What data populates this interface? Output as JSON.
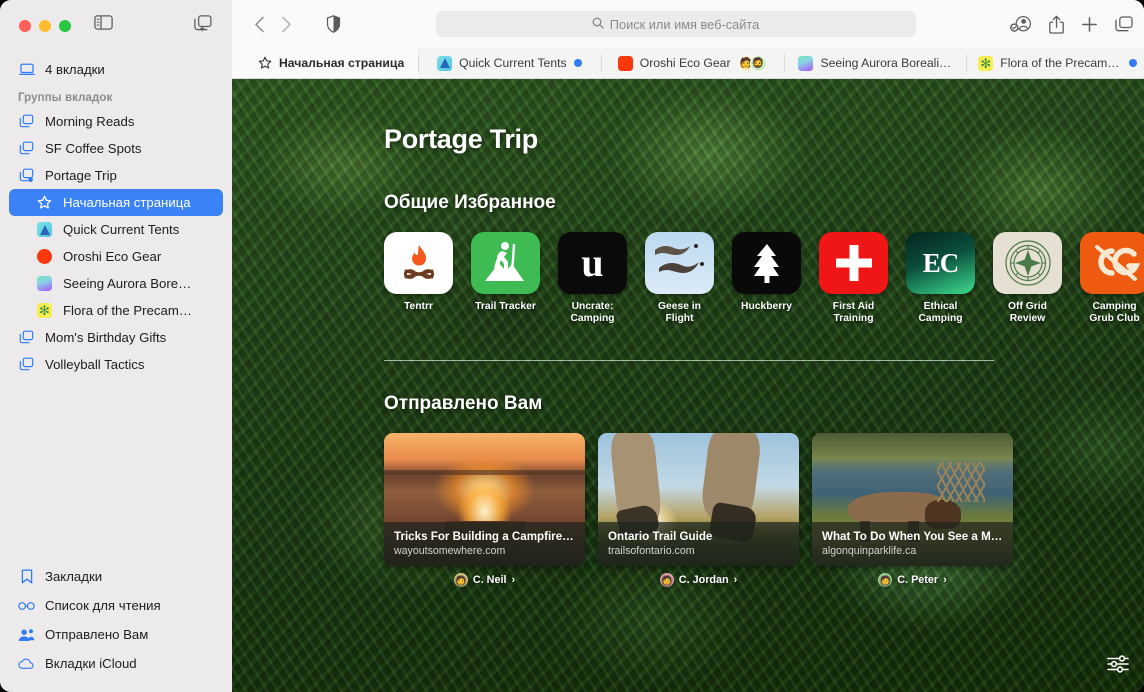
{
  "window": {
    "traffic_lights": [
      "close",
      "minimize",
      "zoom"
    ],
    "sidebar_toggle": "sidebar-toggle",
    "new_tab_group": "new-tab-group"
  },
  "sidebar": {
    "local_tabs": {
      "label": "4 вкладки",
      "icon": "laptop-icon"
    },
    "section_header": "Группы вкладок",
    "groups": [
      {
        "label": "Morning Reads",
        "icon": "tab-group-icon",
        "selected": false
      },
      {
        "label": "SF Coffee Spots",
        "icon": "tab-group-icon",
        "selected": false
      },
      {
        "label": "Portage Trip",
        "icon": "tab-group-shared-icon",
        "selected": false
      }
    ],
    "portage_children": [
      {
        "label": "Начальная страница",
        "icon": "star-icon",
        "selected": true
      },
      {
        "label": "Quick Current Tents",
        "icon": "favicon-tents",
        "selected": false
      },
      {
        "label": "Oroshi Eco Gear",
        "icon": "favicon-oroshi",
        "selected": false
      },
      {
        "label": "Seeing Aurora Bore…",
        "icon": "favicon-aurora",
        "selected": false
      },
      {
        "label": "Flora of the Precam…",
        "icon": "favicon-flora",
        "selected": false
      }
    ],
    "groups_after": [
      {
        "label": "Mom's Birthday Gifts",
        "icon": "tab-group-icon",
        "selected": false
      },
      {
        "label": "Volleyball Tactics",
        "icon": "tab-group-icon",
        "selected": false
      }
    ],
    "bottom": [
      {
        "label": "Закладки",
        "icon": "bookmark-icon"
      },
      {
        "label": "Список для чтения",
        "icon": "glasses-icon"
      },
      {
        "label": "Отправлено Вам",
        "icon": "shared-with-you-icon"
      },
      {
        "label": "Вкладки iCloud",
        "icon": "icloud-icon"
      }
    ]
  },
  "toolbar": {
    "back": "back-icon",
    "forward": "forward-icon",
    "shield": "privacy-shield-icon",
    "address_placeholder": "Поиск или имя веб-сайта",
    "search_icon": "search-icon",
    "profile": "profile-icon",
    "share": "share-icon",
    "new_tab": "plus-icon",
    "tab_overview": "tab-overview-icon"
  },
  "tabs": [
    {
      "label": "Начальная страница",
      "icon": "star-icon",
      "active": true,
      "unread": false,
      "avatars": []
    },
    {
      "label": "Quick Current Tents",
      "icon": "favicon-tents",
      "active": false,
      "unread": true,
      "avatars": []
    },
    {
      "label": "Oroshi Eco Gear",
      "icon": "favicon-oroshi",
      "active": false,
      "unread": false,
      "avatars": [
        "🧑",
        "🧔🏿"
      ]
    },
    {
      "label": "Seeing Aurora Boreali…",
      "icon": "favicon-aurora",
      "active": false,
      "unread": false,
      "avatars": []
    },
    {
      "label": "Flora of the Precambi…",
      "icon": "favicon-flora",
      "active": false,
      "unread": true,
      "avatars": []
    }
  ],
  "start_page": {
    "title": "Portage Trip",
    "favorites_heading": "Общие Избранное",
    "favorites": [
      {
        "label": "Tentrr",
        "art": "campfire-logo"
      },
      {
        "label": "Trail Tracker",
        "art": "hiker-logo"
      },
      {
        "label": "Uncrate: Camping",
        "art": "letter-u-logo"
      },
      {
        "label": "Geese in Flight",
        "art": "geese-photo"
      },
      {
        "label": "Huckberry",
        "art": "pine-tree-logo"
      },
      {
        "label": "First Aid Training",
        "art": "red-cross-logo"
      },
      {
        "label": "Ethical Camping",
        "art": "ec-monogram-logo"
      },
      {
        "label": "Off Grid Review",
        "art": "compass-logo"
      },
      {
        "label": "Camping Grub Club",
        "art": "cg-monogram-logo"
      }
    ],
    "shared_heading": "Отправлено Вам",
    "shared_cards": [
      {
        "title": "Tricks For Building a Campfire—F…",
        "url": "wayoutsomewhere.com",
        "sender": "C. Neil",
        "image": "campfire-at-dusk-photo",
        "avatar_emoji": "🧑",
        "avatar_color": "#dfc98a"
      },
      {
        "title": "Ontario Trail Guide",
        "url": "trailsofontario.com",
        "sender": "C. Jordan",
        "image": "hikers-legs-sunset-photo",
        "avatar_emoji": "🧑🏽",
        "avatar_color": "#e8a9b8"
      },
      {
        "title": "What To Do When You See a Moo…",
        "url": "algonquinparklife.ca",
        "sender": "C. Peter",
        "image": "elk-by-river-photo",
        "avatar_emoji": "🧑🏽",
        "avatar_color": "#a8d8a0"
      }
    ],
    "settings_button": "start-page-settings-icon"
  },
  "colors": {
    "accent": "#3b82f7",
    "sidebar_bg": "#eceaea",
    "toolbar_bg": "#fafafa",
    "tabbar_bg": "#f4f4f4"
  }
}
